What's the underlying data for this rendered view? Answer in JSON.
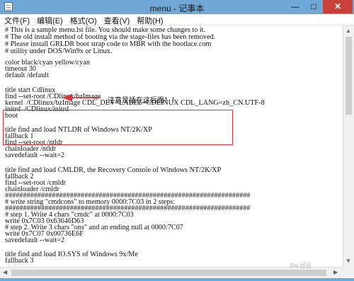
{
  "window": {
    "title": "menu - 记事本",
    "controls": {
      "minimize": "—",
      "maximize": "□",
      "close": "✕"
    }
  },
  "menubar": [
    "文件(F)",
    "编辑(E)",
    "格式(O)",
    "查看(V)",
    "帮助(H)"
  ],
  "editor_lines": [
    "# This is a sample menu.lst file. You should make some changes to it.",
    "# The old install method of booting via the stage-files has been removed.",
    "# Please install GRLDR boot strap code to MBR with the bootlace.com",
    "# utility under DOS/Win9x or Linux.",
    "",
    "color black/cyan yellow/cyan",
    "timeout 30",
    "default /default",
    "",
    "title start Cdlinux",
    "find --set-root /CDlinux/bzImage",
    "kernel  /CDlinux/bzImage CDL_DEV=LABEL=CDLINUX CDL_LANG=zh_CN.UTF-8",
    "initrd  /CDlinux/initrd",
    "boot",
    "",
    "title find and load NTLDR of Windows NT/2K/XP",
    "fallback 1",
    "find --set-root /ntldr",
    "chainloader /ntldr",
    "savedefault --wait=2",
    "",
    "title find and load CMLDR, the Recovery Console of Windows NT/2K/XP",
    "fallback 2",
    "find --set-root /cmldr",
    "chainloader /cmldr",
    "####################################################################",
    "# write string \"cmdcons\" to memory 0000:7C03 in 2 steps:",
    "####################################################################",
    "# step 1. Write 4 chars \"cmdc\" at 0000:7C03",
    "write 0x7C03 0x63646D63",
    "# step 2. Write 3 chars \"ons\" and an ending null at 0000:7C07",
    "write 0x7C07 0x00736E6F",
    "savedefault --wait=2",
    "",
    "title find and load IO.SYS of Windows 9x/Me",
    "fallback 3"
  ],
  "annotation": {
    "text": "注意是插在这后面！！",
    "color": "#e0303a"
  },
  "icons": {
    "app": "notepad-icon",
    "scroll_up": "▲",
    "scroll_down": "▼",
    "scroll_left": "◀",
    "scroll_right": "▶"
  },
  "watermark": "Bai 经验"
}
